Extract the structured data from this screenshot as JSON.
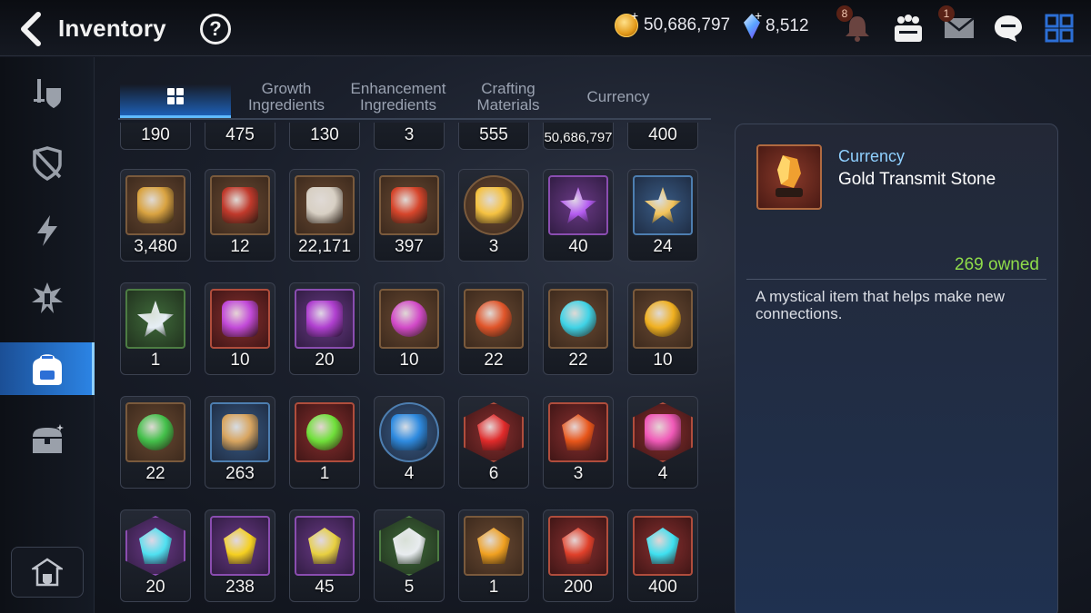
{
  "header": {
    "title": "Inventory",
    "help_label": "?",
    "gold": "50,686,797",
    "crystals": "8,512",
    "plus": "+",
    "notifications_count": "8",
    "mail_count": "1"
  },
  "tabs": [
    {
      "label": "",
      "icon": "grid-icon",
      "active": true
    },
    {
      "label": "Growth Ingredients"
    },
    {
      "label": "Enhancement Ingredients"
    },
    {
      "label": "Crafting Materials"
    },
    {
      "label": "Currency"
    }
  ],
  "sidebar": {
    "items": [
      {
        "icon": "equipment-icon"
      },
      {
        "icon": "artifact-shield-icon"
      },
      {
        "icon": "lightning-icon"
      },
      {
        "icon": "hero-burst-icon"
      },
      {
        "icon": "backpack-icon",
        "active": true
      },
      {
        "icon": "chest-icon"
      }
    ],
    "home_icon": "sanctuary-icon"
  },
  "items": {
    "top_row_counts": [
      "190",
      "475",
      "130",
      "3",
      "555",
      "50,686,797",
      "400"
    ],
    "rows": [
      [
        {
          "qty": "3,480",
          "frame": "brown",
          "icon": "fist-emblem-icon",
          "color": "#d9a341"
        },
        {
          "qty": "12",
          "frame": "brown",
          "icon": "banner-icon",
          "color": "#c0392b"
        },
        {
          "qty": "22,171",
          "frame": "brown",
          "icon": "horse-chess-icon",
          "color": "#d8d0c4"
        },
        {
          "qty": "397",
          "frame": "brown",
          "icon": "red-leaf-icon",
          "color": "#d6452b"
        },
        {
          "qty": "3",
          "frame": "brown round",
          "icon": "mascot-icon",
          "color": "#f5c242"
        },
        {
          "qty": "40",
          "frame": "purple",
          "icon": "purple-flower-icon",
          "color": "#b45cf0"
        },
        {
          "qty": "24",
          "frame": "blue",
          "icon": "gold-flower-icon",
          "color": "#f2c35a"
        }
      ],
      [
        {
          "qty": "1",
          "frame": "green",
          "icon": "white-flower-icon",
          "color": "#e6eef5"
        },
        {
          "qty": "10",
          "frame": "red",
          "icon": "purple-pentagon-icon",
          "color": "#c24ad9"
        },
        {
          "qty": "20",
          "frame": "purple",
          "icon": "purple-triangle-icon",
          "color": "#b040d0"
        },
        {
          "qty": "10",
          "frame": "brown",
          "icon": "purple-oval-icon",
          "color": "#d24ac8"
        },
        {
          "qty": "22",
          "frame": "brown",
          "icon": "red-oval-icon",
          "color": "#e0552a"
        },
        {
          "qty": "22",
          "frame": "brown",
          "icon": "cyan-oval-icon",
          "color": "#3fd3e6"
        },
        {
          "qty": "10",
          "frame": "brown",
          "icon": "gold-oval-icon",
          "color": "#f0b020"
        }
      ],
      [
        {
          "qty": "22",
          "frame": "brown",
          "icon": "green-oval-icon",
          "color": "#43c04a"
        },
        {
          "qty": "263",
          "frame": "blue",
          "icon": "root-herb-icon",
          "color": "#d8a560"
        },
        {
          "qty": "1",
          "frame": "red",
          "icon": "green-orb-icon",
          "color": "#6fe03a"
        },
        {
          "qty": "4",
          "frame": "blue round",
          "icon": "blue-rune-icon",
          "color": "#2f8be0"
        },
        {
          "qty": "6",
          "frame": "red hex",
          "icon": "red-gem-icon",
          "color": "#e02a2a"
        },
        {
          "qty": "3",
          "frame": "red",
          "icon": "orange-rune-gem-icon",
          "color": "#e8561a"
        },
        {
          "qty": "4",
          "frame": "red hex",
          "icon": "pink-potion-icon",
          "color": "#f05ab8"
        }
      ],
      [
        {
          "qty": "20",
          "frame": "purple hex",
          "icon": "cyan-star-stone-icon",
          "color": "#4fe0f0"
        },
        {
          "qty": "238",
          "frame": "purple",
          "icon": "gold-rune-stone-icon",
          "color": "#f5d020"
        },
        {
          "qty": "45",
          "frame": "purple",
          "icon": "yellow-streak-stone-icon",
          "color": "#e8d040"
        },
        {
          "qty": "5",
          "frame": "green hex",
          "icon": "white-star-stone-icon",
          "color": "#e8ecef"
        },
        {
          "qty": "1",
          "frame": "brown",
          "icon": "tan-rune-stone-icon",
          "color": "#f0a020"
        },
        {
          "qty": "200",
          "frame": "red",
          "icon": "dark-crystal-icon",
          "color": "#e0402a"
        },
        {
          "qty": "400",
          "frame": "red",
          "icon": "cyan-shard-icon",
          "color": "#3ee0f0"
        }
      ]
    ]
  },
  "detail": {
    "category": "Currency",
    "name": "Gold Transmit Stone",
    "owned": "269 owned",
    "description": "A mystical item that helps make new connections.",
    "icon": "gold-transmit-stone-icon",
    "icon_color": "#f0a030"
  }
}
